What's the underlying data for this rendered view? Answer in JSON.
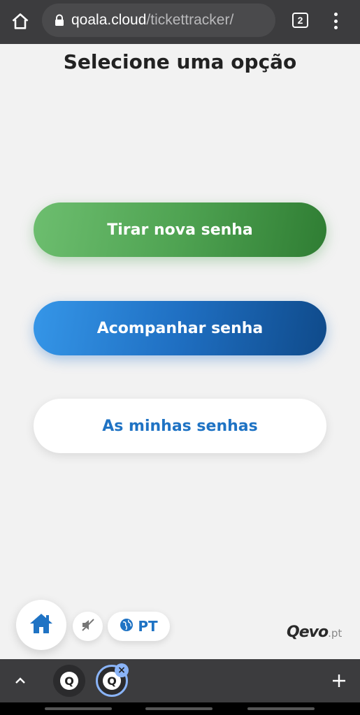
{
  "browser": {
    "url_domain": "qoala.cloud",
    "url_path": "/tickettracker/",
    "tab_count": "2"
  },
  "page": {
    "title": "Selecione uma opção",
    "options": [
      {
        "label": "Tirar nova senha",
        "color": "#4fa352"
      },
      {
        "label": "Acompanhar senha",
        "color": "#1f6fc2"
      },
      {
        "label": "As minhas senhas",
        "color": "#ffffff"
      }
    ]
  },
  "controls": {
    "language": "PT",
    "brand_main": "Qevo",
    "brand_suffix": ".pt"
  },
  "tab_switcher": {
    "tab_letter": "Q"
  },
  "colors": {
    "accent_blue": "#1f73c4",
    "accent_green": "#4fa352"
  }
}
